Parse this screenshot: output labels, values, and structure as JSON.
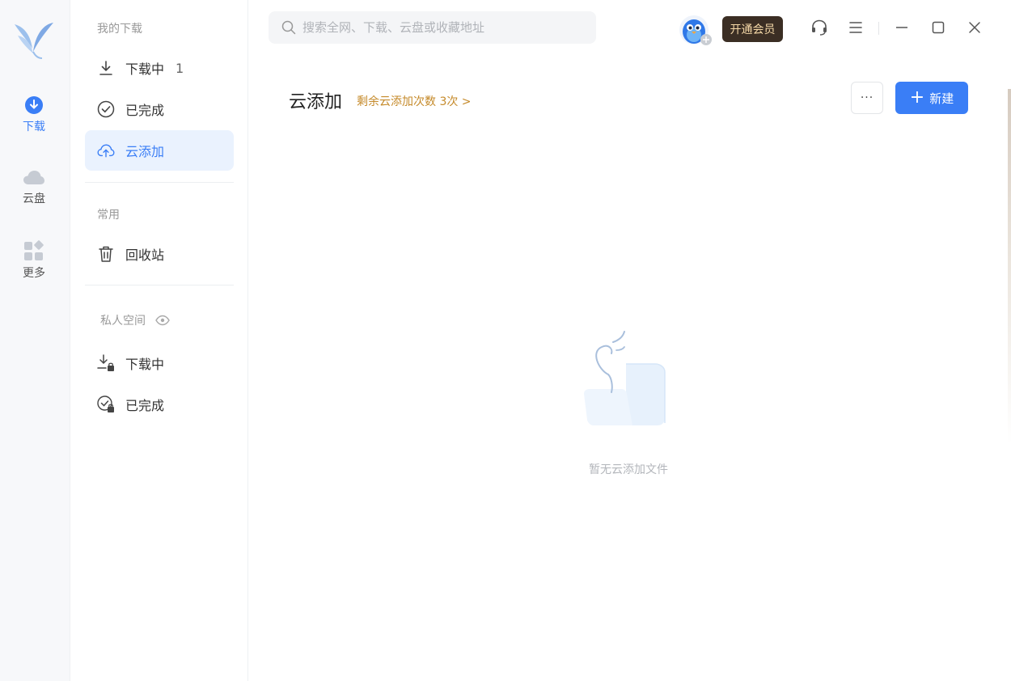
{
  "rail": {
    "items": [
      {
        "label": "下载"
      },
      {
        "label": "云盘"
      },
      {
        "label": "更多"
      }
    ]
  },
  "sidebar": {
    "my_downloads_title": "我的下载",
    "items": [
      {
        "label": "下载中",
        "count": "1"
      },
      {
        "label": "已完成"
      },
      {
        "label": "云添加"
      }
    ],
    "common_title": "常用",
    "common_items": [
      {
        "label": "回收站"
      }
    ],
    "private_title": "私人空间",
    "private_items": [
      {
        "label": "下载中"
      },
      {
        "label": "已完成"
      }
    ]
  },
  "topbar": {
    "search_placeholder": "搜索全网、下载、云盘或收藏地址",
    "vip_label": "开通会员"
  },
  "main": {
    "title": "云添加",
    "quota_text": "剩余云添加次数 3次 >",
    "more_label": "···",
    "new_label": "新建",
    "empty_text": "暂无云添加文件"
  },
  "colors": {
    "accent": "#3a7ef6",
    "quota": "#c58a2a",
    "vip_bg": "#3b2e24"
  }
}
